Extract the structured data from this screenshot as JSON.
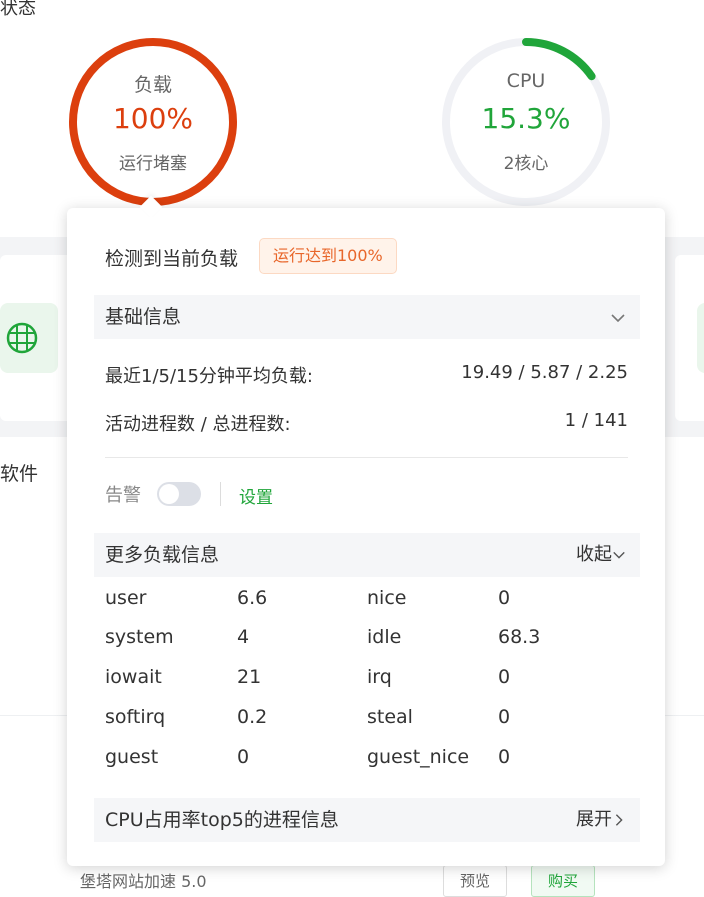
{
  "section_title": "状态",
  "gauges": {
    "load": {
      "label": "负载",
      "value": "100%",
      "sub": "运行堵塞",
      "percent": 100,
      "color": "#dc3f0e"
    },
    "cpu": {
      "label": "CPU",
      "value": "15.3%",
      "sub": "2核心",
      "percent": 15.3,
      "color": "#20a53a"
    }
  },
  "software_title": "软件",
  "bottom_row": {
    "name": "堡塔网站加速 5.0",
    "preview": "预览",
    "buy": "购买"
  },
  "popover": {
    "heading": "检测到当前负载",
    "badge": "运行达到100%",
    "basic_info": {
      "title": "基础信息",
      "rows": [
        {
          "label": "最近1/5/15分钟平均负载:",
          "value": "19.49 / 5.87 / 2.25"
        },
        {
          "label": "活动进程数 / 总进程数:",
          "value": "1 / 141"
        }
      ]
    },
    "alarm": {
      "label": "告警",
      "enabled": false,
      "settings": "设置"
    },
    "more_load": {
      "title": "更多负载信息",
      "action": "收起",
      "items": [
        {
          "key": "user",
          "value": "6.6"
        },
        {
          "key": "nice",
          "value": "0"
        },
        {
          "key": "system",
          "value": "4"
        },
        {
          "key": "idle",
          "value": "68.3"
        },
        {
          "key": "iowait",
          "value": "21"
        },
        {
          "key": "irq",
          "value": "0"
        },
        {
          "key": "softirq",
          "value": "0.2"
        },
        {
          "key": "steal",
          "value": "0"
        },
        {
          "key": "guest",
          "value": "0"
        },
        {
          "key": "guest_nice",
          "value": "0"
        }
      ]
    },
    "top5": {
      "title": "CPU占用率top5的进程信息",
      "action": "展开"
    }
  },
  "colors": {
    "load_red": "#dc3f0e",
    "cpu_green": "#20a53a",
    "badge_orange": "#e8662a"
  }
}
